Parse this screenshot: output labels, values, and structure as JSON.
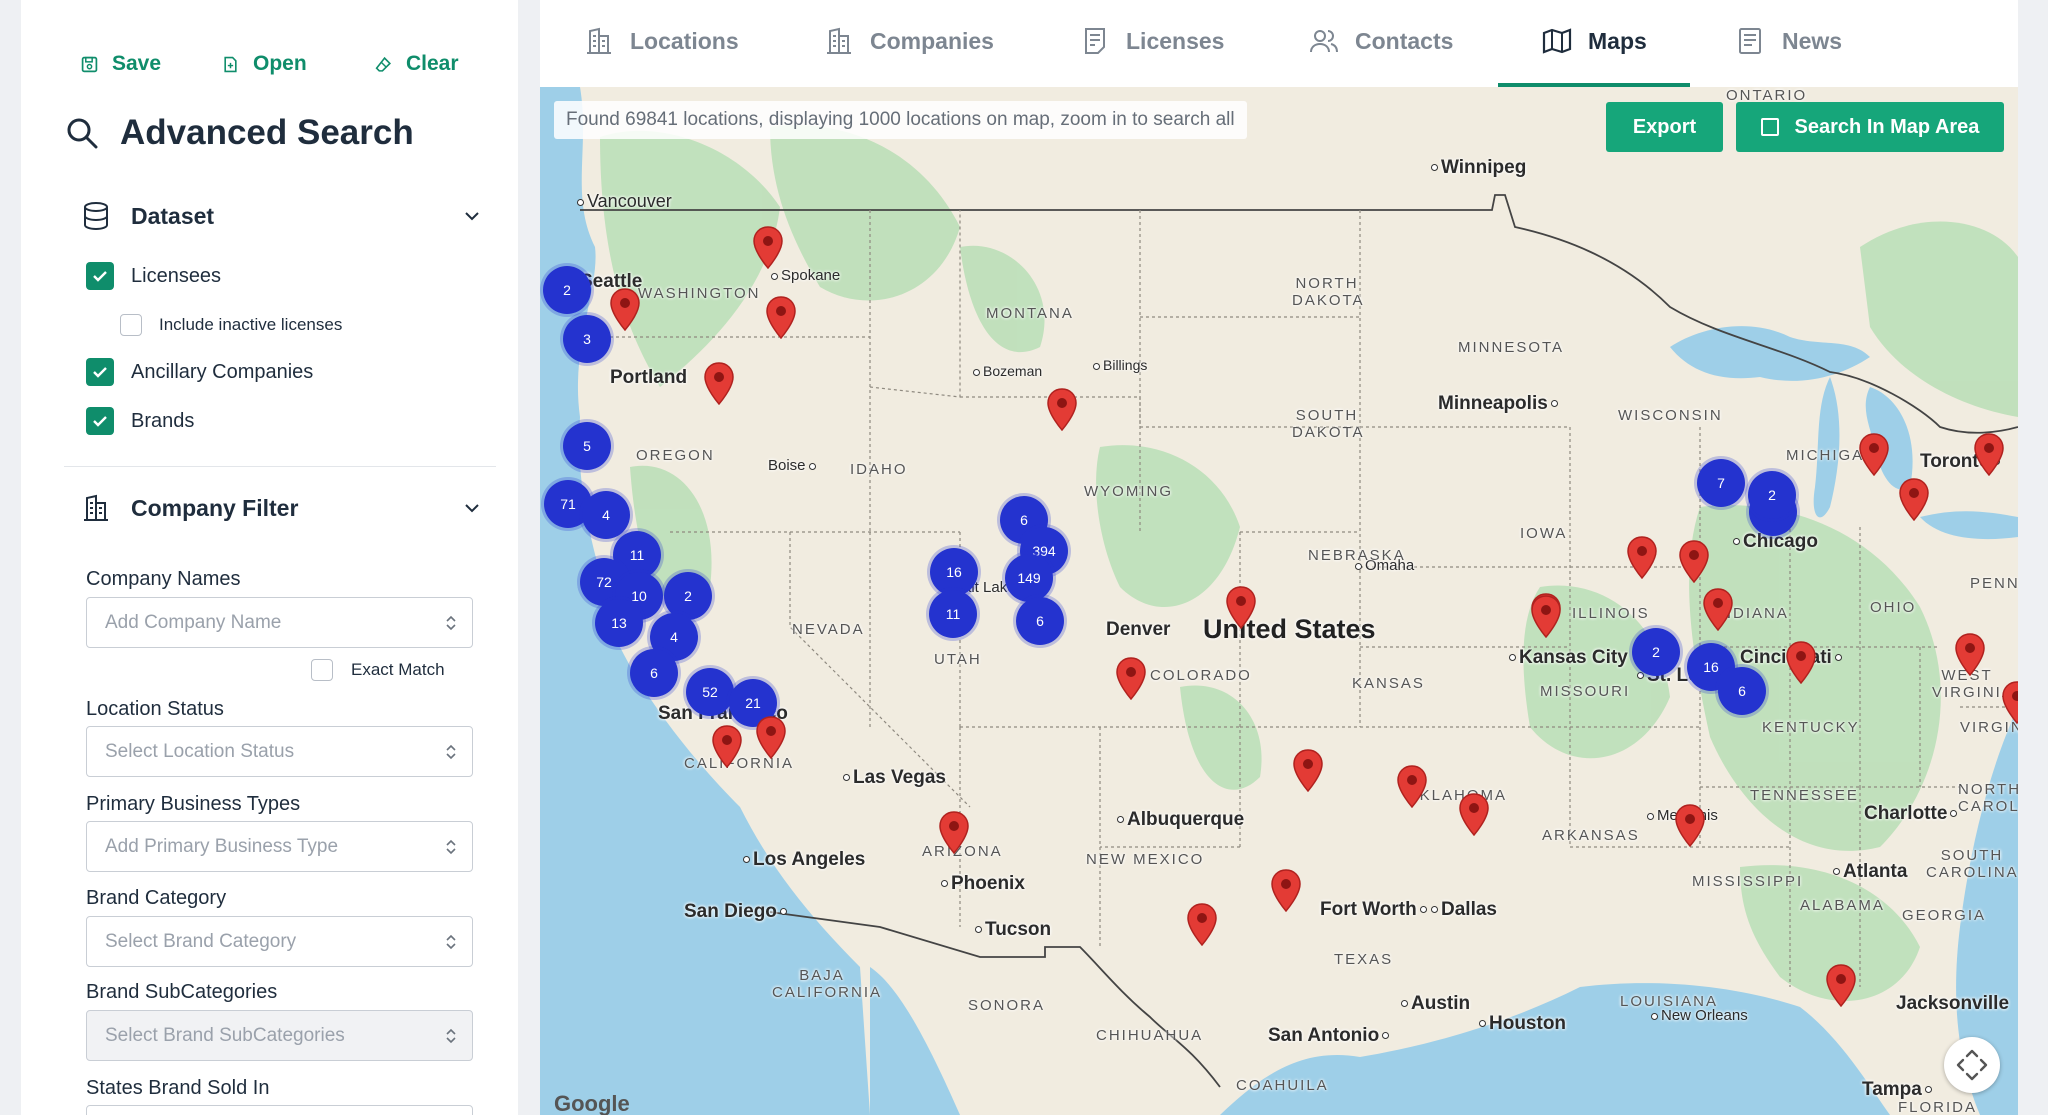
{
  "toolbar": {
    "save": "Save",
    "open": "Open",
    "clear": "Clear"
  },
  "sidebar": {
    "title": "Advanced Search",
    "dataset": {
      "label": "Dataset",
      "options": {
        "licensees": "Licensees",
        "inactive": "Include inactive licenses",
        "ancillary": "Ancillary Companies",
        "brands": "Brands"
      }
    },
    "company_filter": {
      "label": "Company Filter",
      "company_names": {
        "label": "Company Names",
        "placeholder": "Add Company Name"
      },
      "exact_match": "Exact Match",
      "location_status": {
        "label": "Location Status",
        "placeholder": "Select Location Status"
      },
      "primary_business": {
        "label": "Primary Business Types",
        "placeholder": "Add Primary Business Type"
      },
      "brand_category": {
        "label": "Brand Category",
        "placeholder": "Select Brand Category"
      },
      "brand_subcategories": {
        "label": "Brand SubCategories",
        "placeholder": "Select Brand SubCategories"
      },
      "states_sold": {
        "label": "States Brand Sold In"
      }
    }
  },
  "tabs": {
    "locations": "Locations",
    "companies": "Companies",
    "licenses": "Licenses",
    "contacts": "Contacts",
    "maps": "Maps",
    "news": "News"
  },
  "map": {
    "status": "Found 69841 locations, displaying 1000 locations on map, zoom in to search all",
    "export": "Export",
    "search_area": "Search In Map Area",
    "country": "United States",
    "google": "Google",
    "cities": [
      "Vancouver",
      "Winnipeg",
      "Spokane",
      "Portland",
      "Bozeman",
      "Billings",
      "Minneapolis",
      "Boise",
      "Toronto",
      "Chicago",
      "Salt Lake City",
      "Omaha",
      "Denver",
      "Kansas City",
      "Cincinnati",
      "St. Louis",
      "Las Vegas",
      "Albuquerque",
      "Memphis",
      "Charlotte",
      "Los Angeles",
      "Phoenix",
      "Atlanta",
      "San Diego",
      "Tucson",
      "Fort Worth",
      "Dallas",
      "Austin",
      "Houston",
      "New Orleans",
      "San Antonio",
      "Jacksonville",
      "Tampa",
      "Seattle",
      "San Francisco"
    ],
    "states": [
      "ONTARIO",
      "WASHINGTON",
      "NORTH DAKOTA",
      "MONTANA",
      "MINNESOTA",
      "SOUTH DAKOTA",
      "WISCONSIN",
      "OREGON",
      "IDAHO",
      "WYOMING",
      "MICHIGAN",
      "IOWA",
      "NEBRASKA",
      "ILLINOIS",
      "INDIANA",
      "OHIO",
      "NEVADA",
      "UTAH",
      "COLORADO",
      "KANSAS",
      "MISSOURI",
      "WEST VIRGINIA",
      "KENTUCKY",
      "VIRGINIA",
      "CALIFORNIA",
      "OKLAHOMA",
      "TENNESSEE",
      "NORTH CAROLINA",
      "ARKANSAS",
      "SOUTH CAROLINA",
      "ARIZONA",
      "NEW MEXICO",
      "MISSISSIPPI",
      "ALABAMA",
      "GEORGIA",
      "TEXAS",
      "LOUISIANA",
      "BAJA CALIFORNIA",
      "SONORA",
      "CHIHUAHUA",
      "COAHUILA",
      "FLORIDA",
      "PENNSYLVANIA"
    ],
    "clusters": [
      "2",
      "3",
      "5",
      "71",
      "4",
      "11",
      "72",
      "10",
      "2",
      "13",
      "4",
      "6",
      "52",
      "21",
      "6",
      "394",
      "149",
      "16",
      "11",
      "6",
      "2",
      "7",
      "2",
      "2",
      "16",
      "6"
    ],
    "pin_count": 28
  }
}
